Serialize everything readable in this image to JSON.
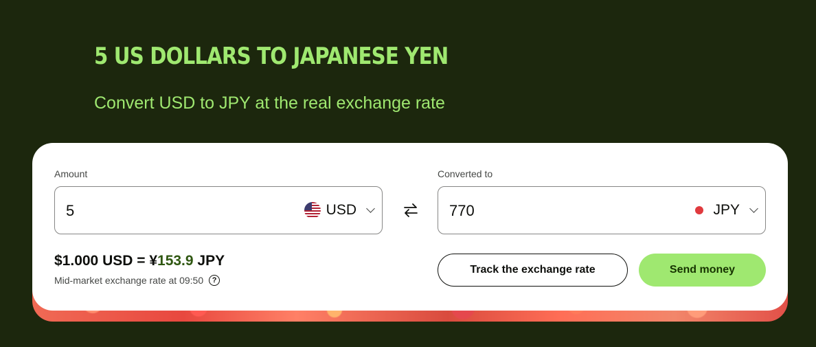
{
  "header": {
    "title": "5 US DOLLARS TO JAPANESE YEN",
    "subtitle": "Convert USD to JPY at the real exchange rate"
  },
  "converter": {
    "amount_label": "Amount",
    "amount_value": "5",
    "from_currency": "USD",
    "from_flag_icon": "us-flag-icon",
    "converted_label": "Converted to",
    "converted_value": "770",
    "to_currency": "JPY",
    "to_flag_icon": "jp-flag-icon",
    "swap_icon": "swap-arrows-icon"
  },
  "rate": {
    "base": "$1.000 USD = ¥",
    "value": "153.9",
    "quote": " JPY",
    "note": "Mid-market exchange rate at 09:50",
    "help_icon": "?"
  },
  "actions": {
    "track_label": "Track the exchange rate",
    "send_label": "Send money"
  },
  "colors": {
    "background": "#1c270d",
    "accent": "#9fe870",
    "rate_green": "#2f5711",
    "card": "#ffffff"
  }
}
